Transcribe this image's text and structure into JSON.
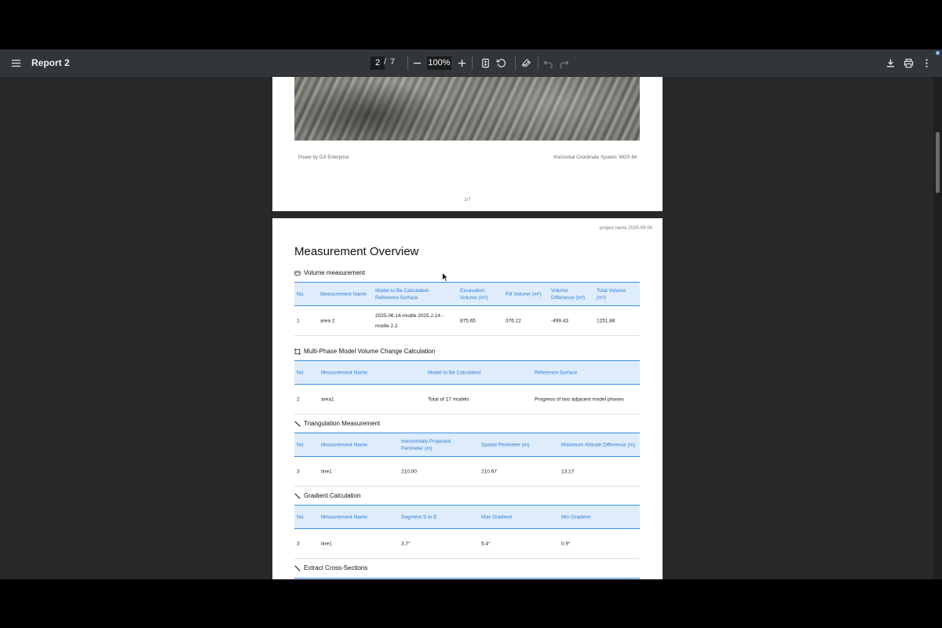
{
  "toolbar": {
    "title": "Report 2",
    "current_page": "2",
    "page_separator": "/",
    "total_pages": "7",
    "zoom": "100%"
  },
  "page1": {
    "footer_left": "Power by DJI Enterprise",
    "footer_right": "Horizontal Coordinate System: WGS 84",
    "page_number": "1/7"
  },
  "page2": {
    "header": "project name 2025-09-04",
    "title": "Measurement Overview",
    "volume": {
      "title": "Volume measurement",
      "headers": [
        "No.",
        "Measurement Name",
        "Model to Be Calculated-Reference Surface",
        "Excavation Volume (m³)",
        "Fill Volume (m³)",
        "Volume Difference (m³)",
        "Total Volume (m³)"
      ],
      "row": [
        "1",
        "area 2",
        "2025.06.14-modle 2025.2.14 -modle 2.2",
        "875.65",
        "376.22",
        "-499.43",
        "1251.88"
      ]
    },
    "multiphase": {
      "title": "Multi-Phase Model Volume Change Calculation",
      "headers": [
        "No.",
        "Measurement Name",
        "Model to Be Calculated",
        "Reference Surface"
      ],
      "row": [
        "2",
        "area1",
        "Total of 17 models",
        "Progress of two adjacent model phases"
      ]
    },
    "triangulation": {
      "title": "Triangulation Measurement",
      "headers": [
        "No.",
        "Measurement Name",
        "Horizontally Projected Perimeter (m)",
        "Spatial Perimeter (m)",
        "Maximum Altitude Difference (m)"
      ],
      "row": [
        "3",
        "line1",
        "210.00",
        "210.67",
        "13.17"
      ]
    },
    "gradient": {
      "title": "Gradient Calculation",
      "headers": [
        "No.",
        "Measurement Name",
        "Segment S to E",
        "Max Gradient",
        "Min Gradient"
      ],
      "row": [
        "3",
        "line1",
        "3.7°",
        "5.4°",
        "0.9°"
      ]
    },
    "cross_sections": {
      "title": "Extract Cross-Sections"
    }
  },
  "icons": [
    "menu-icon",
    "zoom-out-icon",
    "zoom-in-icon",
    "fit-page-icon",
    "rotate-icon",
    "annotate-icon",
    "undo-icon",
    "redo-icon",
    "download-icon",
    "print-icon",
    "more-options-icon"
  ],
  "colors": {
    "toolbar_bg": "#323639",
    "viewer_bg": "#282828",
    "table_header_bg": "#deecfb",
    "table_accent": "#2f80d6"
  }
}
